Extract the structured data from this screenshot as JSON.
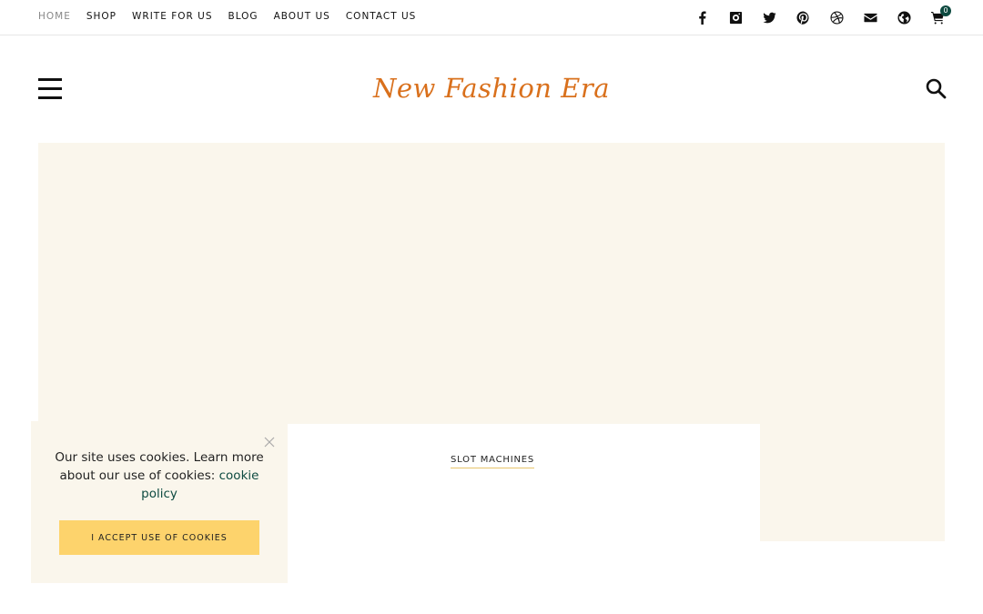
{
  "top_nav": [
    {
      "label": "HOME",
      "active": true
    },
    {
      "label": "SHOP"
    },
    {
      "label": "WRITE FOR US"
    },
    {
      "label": "BLOG"
    },
    {
      "label": "ABOUT US"
    },
    {
      "label": "CONTACT US"
    }
  ],
  "social_icons": [
    "facebook-icon",
    "instagram-icon",
    "twitter-icon",
    "pinterest-icon",
    "dribbble-icon",
    "email-icon",
    "globe-icon",
    "cart-icon"
  ],
  "cart": {
    "count": "0"
  },
  "header": {
    "logo": "New Fashion Era"
  },
  "card": {
    "tag": "SLOT MACHINES"
  },
  "cookie": {
    "text": "Our site uses cookies. Learn more about our use of cookies:",
    "link": "cookie policy",
    "button": "I ACCEPT USE OF COOKIES"
  },
  "colors": {
    "accent": "#d9701c",
    "hero_bg": "#faf6ec",
    "button": "#fdd36c",
    "link": "#0d4a40"
  }
}
